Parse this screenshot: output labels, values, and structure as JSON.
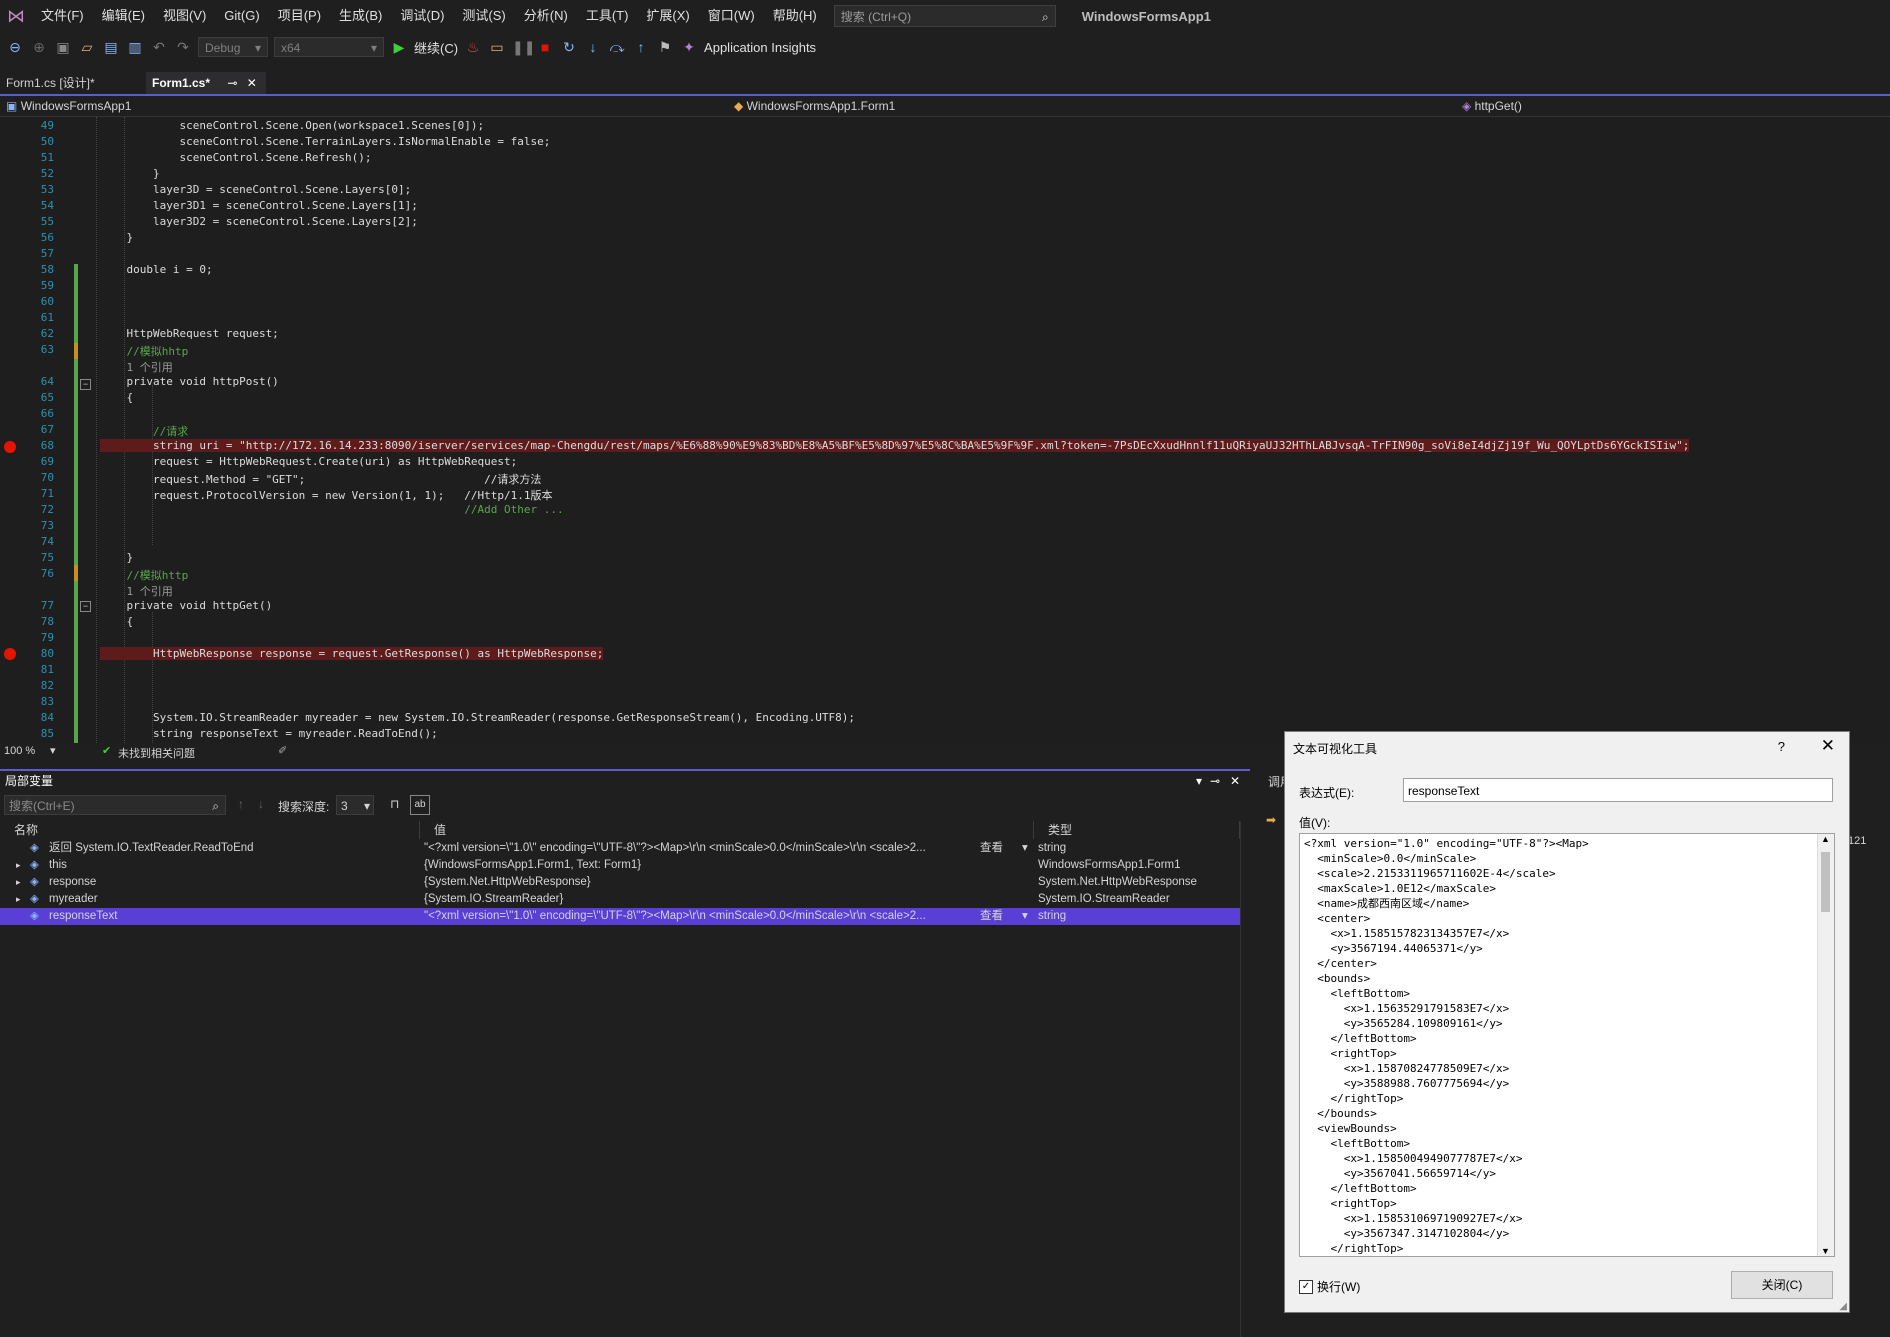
{
  "menubar": {
    "items": [
      "文件(F)",
      "编辑(E)",
      "视图(V)",
      "Git(G)",
      "项目(P)",
      "生成(B)",
      "调试(D)",
      "测试(S)",
      "分析(N)",
      "工具(T)",
      "扩展(X)",
      "窗口(W)",
      "帮助(H)"
    ],
    "search_placeholder": "搜索 (Ctrl+Q)",
    "app_name": "WindowsFormsApp1"
  },
  "toolbar": {
    "config": "Debug",
    "platform": "x64",
    "continue_label": "继续(C)",
    "insights_label": "Application Insights"
  },
  "tabs": [
    {
      "label": "Form1.cs [设计]*"
    },
    {
      "label": "Form1.cs*"
    }
  ],
  "navbar": {
    "project": "WindowsFormsApp1",
    "class": "WindowsFormsApp1.Form1",
    "member": "httpGet()"
  },
  "code": {
    "lines": [
      {
        "n": "49",
        "t": "            sceneControl.Scene.Open(workspace1.Scenes[0]);"
      },
      {
        "n": "50",
        "t": "            sceneControl.Scene.TerrainLayers.IsNormalEnable = false;"
      },
      {
        "n": "51",
        "t": "            sceneControl.Scene.Refresh();"
      },
      {
        "n": "52",
        "t": "        }"
      },
      {
        "n": "53",
        "t": "        layer3D = sceneControl.Scene.Layers[0];"
      },
      {
        "n": "54",
        "t": "        layer3D1 = sceneControl.Scene.Layers[1];"
      },
      {
        "n": "55",
        "t": "        layer3D2 = sceneControl.Scene.Layers[2];"
      },
      {
        "n": "56",
        "t": "    }"
      },
      {
        "n": "57",
        "t": ""
      },
      {
        "n": "58",
        "t": "    double i = 0;"
      },
      {
        "n": "59",
        "t": ""
      },
      {
        "n": "60",
        "t": ""
      },
      {
        "n": "61",
        "t": ""
      },
      {
        "n": "62",
        "t": "    HttpWebRequest request;"
      },
      {
        "n": "63",
        "t": "    //模拟hhtp"
      },
      {
        "n": "",
        "t": "    1 个引用"
      },
      {
        "n": "64",
        "t": "    private void httpPost()"
      },
      {
        "n": "65",
        "t": "    {"
      },
      {
        "n": "66",
        "t": ""
      },
      {
        "n": "67",
        "t": "        //请求"
      },
      {
        "n": "68",
        "t": "        string uri = \"http://172.16.14.233:8090/iserver/services/map-Chengdu/rest/maps/%E6%88%90%E9%83%BD%E8%A5%BF%E5%8D%97%E5%8C%BA%E5%9F%9F.xml?token=-7PsDEcXxudHnnlf11uQRiyaUJ32HThLABJvsqA-TrFIN90g_soVi8eI4djZj19f_Wu_QOYLptDs6YGckISIiw\";"
      },
      {
        "n": "69",
        "t": "        request = HttpWebRequest.Create(uri) as HttpWebRequest;"
      },
      {
        "n": "70",
        "t": "        request.Method = \"GET\";                           //请求方法"
      },
      {
        "n": "71",
        "t": "        request.ProtocolVersion = new Version(1, 1);   //Http/1.1版本"
      },
      {
        "n": "72",
        "t": "                                                       //Add Other ..."
      },
      {
        "n": "73",
        "t": ""
      },
      {
        "n": "74",
        "t": ""
      },
      {
        "n": "75",
        "t": "    }"
      },
      {
        "n": "76",
        "t": "    //模拟http"
      },
      {
        "n": "",
        "t": "    1 个引用"
      },
      {
        "n": "77",
        "t": "    private void httpGet()"
      },
      {
        "n": "78",
        "t": "    {"
      },
      {
        "n": "79",
        "t": ""
      },
      {
        "n": "80",
        "t": "        HttpWebResponse response = request.GetResponse() as HttpWebResponse;"
      },
      {
        "n": "81",
        "t": ""
      },
      {
        "n": "82",
        "t": ""
      },
      {
        "n": "83",
        "t": ""
      },
      {
        "n": "84",
        "t": "        System.IO.StreamReader myreader = new System.IO.StreamReader(response.GetResponseStream(), Encoding.UTF8);"
      },
      {
        "n": "85",
        "t": "        string responseText = myreader.ReadToEnd();"
      }
    ]
  },
  "editor_status": {
    "zoom": "100 %",
    "issues": "未找到相关问题"
  },
  "locals": {
    "title": "局部变量",
    "search_placeholder": "搜索(Ctrl+E)",
    "depth_label": "搜索深度:",
    "depth_value": "3",
    "columns": [
      "名称",
      "值",
      "类型"
    ],
    "view_label": "查看",
    "rows": [
      {
        "name": "返回 System.IO.TextReader.ReadToEnd",
        "value": "\"<?xml version=\\\"1.0\\\" encoding=\\\"UTF-8\\\"?><Map>\\r\\n  <minScale>0.0</minScale>\\r\\n  <scale>2...",
        "type": "string",
        "selected": false,
        "expandable": false
      },
      {
        "name": "this",
        "value": "{WindowsFormsApp1.Form1, Text: Form1}",
        "type": "WindowsFormsApp1.Form1",
        "selected": false,
        "expandable": true
      },
      {
        "name": "response",
        "value": "{System.Net.HttpWebResponse}",
        "type": "System.Net.HttpWebResponse",
        "selected": false,
        "expandable": true
      },
      {
        "name": "myreader",
        "value": "{System.IO.StreamReader}",
        "type": "System.IO.StreamReader",
        "selected": false,
        "expandable": true
      },
      {
        "name": "responseText",
        "value": "\"<?xml version=\\\"1.0\\\" encoding=\\\"UTF-8\\\"?><Map>\\r\\n  <minScale>0.0</minScale>\\r\\n  <scale>2...",
        "type": "string",
        "selected": true,
        "expandable": false
      }
    ]
  },
  "rightstrip": {
    "tab_label": "调用",
    "value_fragment": "121"
  },
  "dialog": {
    "title": "文本可视化工具",
    "help": "?",
    "expression_label": "表达式(E):",
    "expression_value": "responseText",
    "value_label": "值(V):",
    "value_text": "<?xml version=\"1.0\" encoding=\"UTF-8\"?><Map>\n  <minScale>0.0</minScale>\n  <scale>2.2153311965711602E-4</scale>\n  <maxScale>1.0E12</maxScale>\n  <name>成都西南区域</name>\n  <center>\n    <x>1.1585157823134357E7</x>\n    <y>3567194.44065371</y>\n  </center>\n  <bounds>\n    <leftBottom>\n      <x>1.15635291791583E7</x>\n      <y>3565284.109809161</y>\n    </leftBottom>\n    <rightTop>\n      <x>1.15870824778509E7</x>\n      <y>3588988.7607775694</y>\n    </rightTop>\n  </bounds>\n  <viewBounds>\n    <leftBottom>\n      <x>1.1585004949077787E7</x>\n      <y>3567041.56659714</y>\n    </leftBottom>\n    <rightTop>\n      <x>1.1585310697190927E7</x>\n      <y>3567347.3147102804</y>\n    </rightTop>",
    "wrap_label": "换行(W)",
    "close_label": "关闭(C)"
  }
}
